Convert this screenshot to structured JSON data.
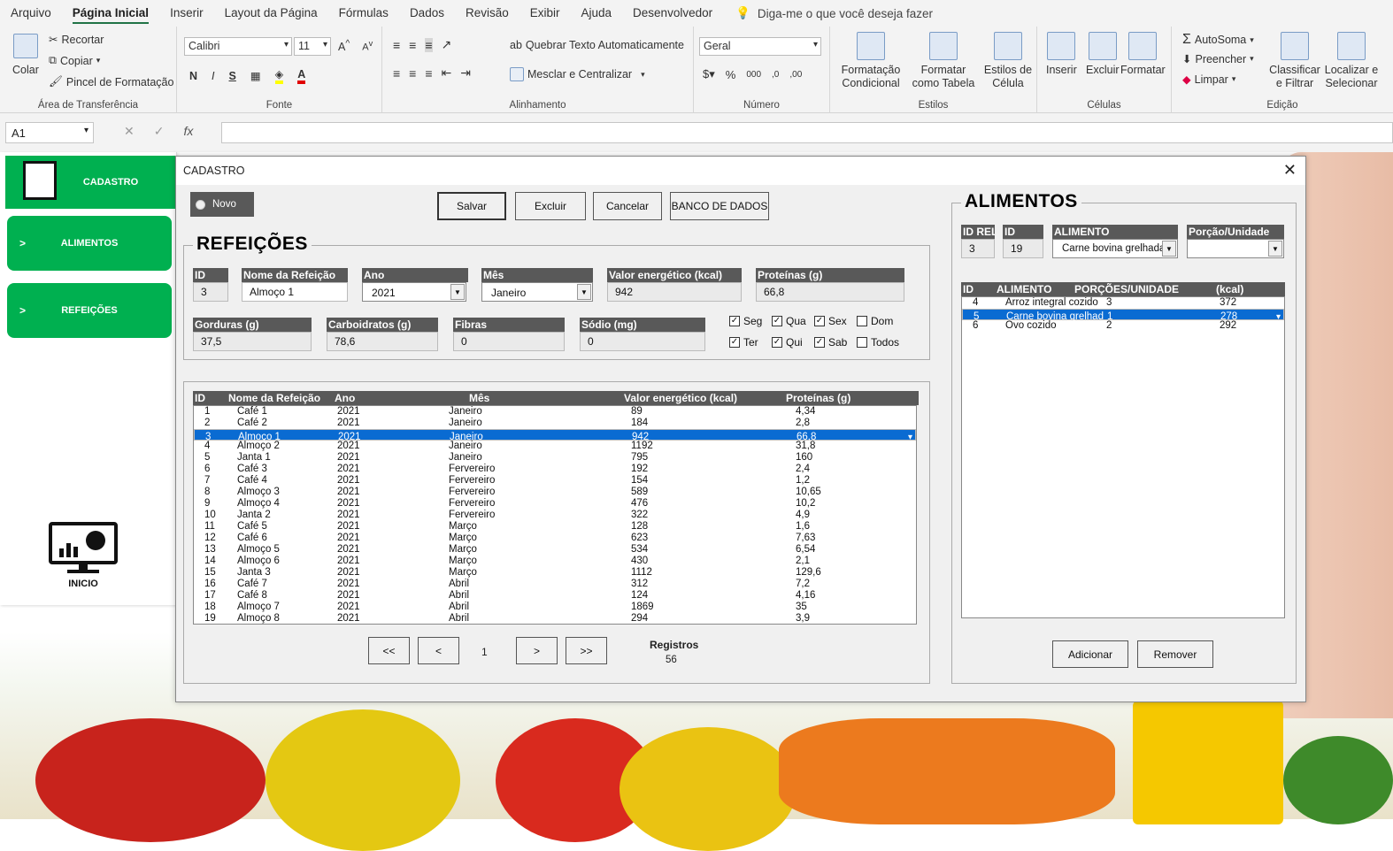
{
  "menu": {
    "tabs": [
      "Arquivo",
      "Página Inicial",
      "Inserir",
      "Layout da Página",
      "Fórmulas",
      "Dados",
      "Revisão",
      "Exibir",
      "Ajuda",
      "Desenvolvedor"
    ],
    "tellme": "Diga-me o que você deseja fazer"
  },
  "ribbon": {
    "clipboard": {
      "paste": "Colar",
      "cut": "Recortar",
      "copy": "Copiar",
      "painter": "Pincel de Formatação",
      "name": "Área de Transferência"
    },
    "font": {
      "family": "Calibri",
      "size": "11",
      "bold": "N",
      "italic": "I",
      "underline": "S",
      "name": "Fonte"
    },
    "alignment": {
      "wrap": "Quebrar Texto Automaticamente",
      "merge": "Mesclar e Centralizar",
      "name": "Alinhamento"
    },
    "number": {
      "format": "Geral",
      "name": "Número"
    },
    "styles": {
      "cond": "Formatação Condicional",
      "table": "Formatar como Tabela",
      "cell": "Estilos de Célula",
      "name": "Estilos"
    },
    "cells": {
      "insert": "Inserir",
      "delete": "Excluir",
      "format": "Formatar",
      "name": "Células"
    },
    "editing": {
      "autosum": "AutoSoma",
      "fill": "Preencher",
      "clear": "Limpar",
      "sort": "Classificar e Filtrar",
      "find": "Localizar e Selecionar",
      "name": "Edição"
    }
  },
  "formula_bar": {
    "namebox": "A1",
    "fx": "fx"
  },
  "sidebar": {
    "cadastro": "CADASTRO",
    "alimentos": "ALIMENTOS",
    "refeicoes": "REFEIÇÕES",
    "inicio": "INICIO",
    "arrow": ">"
  },
  "dialog": {
    "title": "CADASTRO",
    "close": "✕",
    "novo": "Novo",
    "buttons": {
      "salvar": "Salvar",
      "excluir": "Excluir",
      "cancelar": "Cancelar",
      "banco": "BANCO DE DADOS"
    },
    "refeicoes_frame": "REFEIÇÕES",
    "fields": {
      "id": {
        "label": "ID",
        "value": "3"
      },
      "nome": {
        "label": "Nome da Refeição",
        "value": "Almoço 1"
      },
      "ano": {
        "label": "Ano",
        "value": "2021"
      },
      "mes": {
        "label": "Mês",
        "value": "Janeiro"
      },
      "kcal": {
        "label": "Valor energético (kcal)",
        "value": "942"
      },
      "prot": {
        "label": "Proteínas (g)",
        "value": "66,8"
      },
      "gord": {
        "label": "Gorduras (g)",
        "value": "37,5"
      },
      "carb": {
        "label": "Carboidratos (g)",
        "value": "78,6"
      },
      "fibras": {
        "label": "Fibras",
        "value": "0"
      },
      "sodio": {
        "label": "Sódio (mg)",
        "value": "0"
      }
    },
    "days": [
      {
        "label": "Seg",
        "checked": true
      },
      {
        "label": "Qua",
        "checked": true
      },
      {
        "label": "Sex",
        "checked": true
      },
      {
        "label": "Dom",
        "checked": false
      },
      {
        "label": "Ter",
        "checked": true
      },
      {
        "label": "Qui",
        "checked": true
      },
      {
        "label": "Sab",
        "checked": true
      },
      {
        "label": "Todos",
        "checked": false
      }
    ],
    "list_headers": [
      "ID",
      "Nome da Refeição",
      "Ano",
      "Mês",
      "Valor energético (kcal)",
      "Proteínas (g)"
    ],
    "list_rows": [
      [
        "1",
        "Café 1",
        "2021",
        "Janeiro",
        "89",
        "4,34"
      ],
      [
        "2",
        "Café 2",
        "2021",
        "Janeiro",
        "184",
        "2,8"
      ],
      [
        "3",
        "Almoço 1",
        "2021",
        "Janeiro",
        "942",
        "66,8"
      ],
      [
        "4",
        "Almoço 2",
        "2021",
        "Janeiro",
        "1192",
        "31,8"
      ],
      [
        "5",
        "Janta 1",
        "2021",
        "Janeiro",
        "795",
        "160"
      ],
      [
        "6",
        "Café 3",
        "2021",
        "Fervereiro",
        "192",
        "2,4"
      ],
      [
        "7",
        "Café 4",
        "2021",
        "Fervereiro",
        "154",
        "1,2"
      ],
      [
        "8",
        "Almoço 3",
        "2021",
        "Fervereiro",
        "589",
        "10,65"
      ],
      [
        "9",
        "Almoço 4",
        "2021",
        "Fervereiro",
        "476",
        "10,2"
      ],
      [
        "10",
        "Janta 2",
        "2021",
        "Fervereiro",
        "322",
        "4,9"
      ],
      [
        "11",
        "Café 5",
        "2021",
        "Março",
        "128",
        "1,6"
      ],
      [
        "12",
        "Café 6",
        "2021",
        "Março",
        "623",
        "7,63"
      ],
      [
        "13",
        "Almoço 5",
        "2021",
        "Março",
        "534",
        "6,54"
      ],
      [
        "14",
        "Almoço 6",
        "2021",
        "Março",
        "430",
        "2,1"
      ],
      [
        "15",
        "Janta 3",
        "2021",
        "Março",
        "1112",
        "129,6"
      ],
      [
        "16",
        "Café 7",
        "2021",
        "Abril",
        "312",
        "7,2"
      ],
      [
        "17",
        "Café 8",
        "2021",
        "Abril",
        "124",
        "4,16"
      ],
      [
        "18",
        "Almoço 7",
        "2021",
        "Abril",
        "1869",
        "35"
      ],
      [
        "19",
        "Almoço 8",
        "2021",
        "Abril",
        "294",
        "3,9"
      ]
    ],
    "selected_row": 2,
    "pager": {
      "first": "<<",
      "prev": "<",
      "page": "1",
      "next": ">",
      "last": ">>",
      "registros_label": "Registros",
      "registros": "56"
    },
    "alimentos_frame": "ALIMENTOS",
    "alim_fields": {
      "idrel": {
        "label": "ID REL",
        "value": "3"
      },
      "id": {
        "label": "ID",
        "value": "19"
      },
      "alimento": {
        "label": "ALIMENTO",
        "value": "Carne bovina grelhada"
      },
      "porcao": {
        "label": "Porção/Unidade",
        "value": ""
      }
    },
    "alim_headers": [
      "ID",
      "ALIMENTO",
      "PORÇÕES/UNIDADE",
      "(kcal)"
    ],
    "alim_rows": [
      [
        "4",
        "Arroz integral cozido",
        "3",
        "372"
      ],
      [
        "5",
        "Carne bovina grelhad",
        "1",
        "278"
      ],
      [
        "6",
        "Ovo cozido",
        "2",
        "292"
      ]
    ],
    "alim_selected": 1,
    "adicionar": "Adicionar",
    "remover": "Remover"
  },
  "colors": {
    "accent_green": "#00b050",
    "selection_blue": "#0a6bd2",
    "header_gray": "#595959",
    "excel_green": "#217346"
  }
}
